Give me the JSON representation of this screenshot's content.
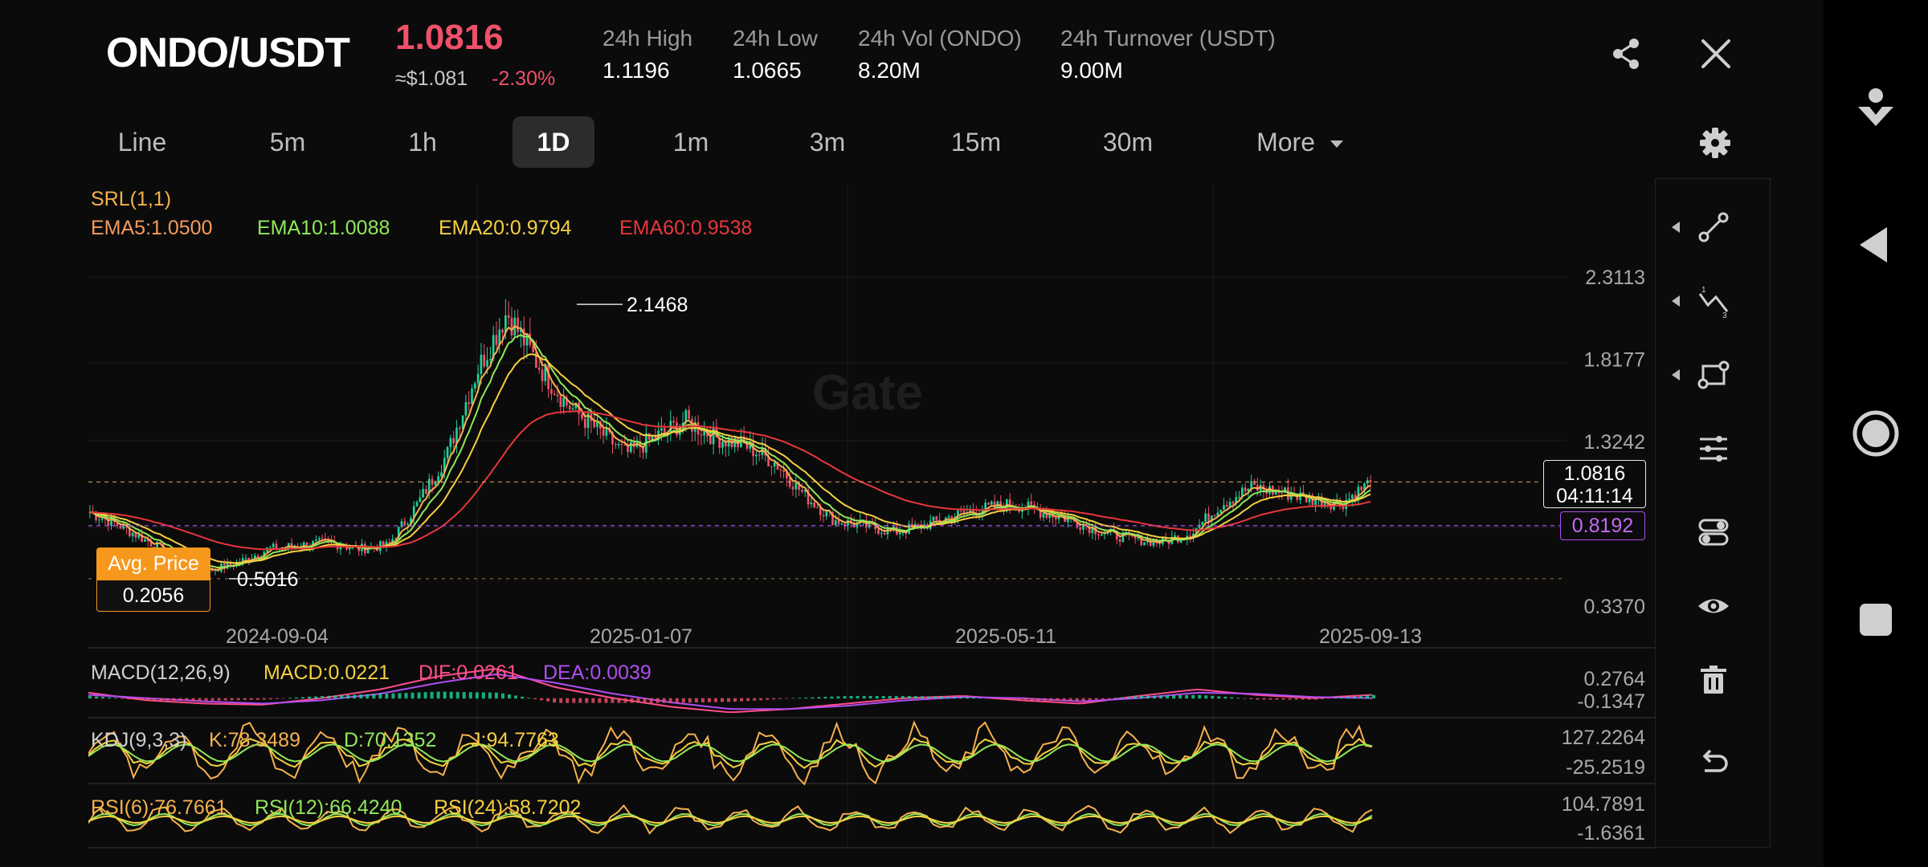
{
  "header": {
    "pair": "ONDO/USDT",
    "price": "1.0816",
    "approx": "≈$1.081",
    "change": "-2.30%",
    "stats": [
      {
        "label": "24h High",
        "value": "1.1196"
      },
      {
        "label": "24h Low",
        "value": "1.0665"
      },
      {
        "label": "24h Vol (ONDO)",
        "value": "8.20M"
      },
      {
        "label": "24h Turnover (USDT)",
        "value": "9.00M"
      }
    ],
    "share_icon": "share-icon",
    "close_icon": "close-icon"
  },
  "tabs": {
    "items": [
      "Line",
      "5m",
      "1h",
      "1D",
      "1m",
      "3m",
      "15m",
      "30m",
      "More"
    ],
    "active": "1D",
    "settings_icon": "gear-icon"
  },
  "indicators": {
    "srl": "SRL(1,1)",
    "ema5": "EMA5:1.0500",
    "ema10": "EMA10:1.0088",
    "ema20": "EMA20:0.9794",
    "ema60": "EMA60:0.9538",
    "macd_title": "MACD(12,26,9)",
    "macd_value": "MACD:0.0221",
    "dif": "DIF:0.0261",
    "dea": "DEA:0.0039",
    "kdj_title": "KDJ(9,3,3)",
    "k": "K:78.3489",
    "d": "D:70.1352",
    "j": "J:94.7763",
    "rsi6": "RSI(6):76.7661",
    "rsi12": "RSI(12):66.4240",
    "rsi24": "RSI(24):58.7202"
  },
  "labels": {
    "avg_price_label": "Avg. Price",
    "avg_price_value": "0.2056",
    "current_price": "1.0816",
    "countdown": "04:11:14",
    "avg_line_value": "0.8192",
    "watermark": "Gate"
  },
  "colors": {
    "up": "#1ed39a",
    "down": "#f0516a",
    "ema5": "#f6b04e",
    "ema10": "#8fe85a",
    "ema20": "#f4d03f",
    "ema60": "#e8363c",
    "dif": "#ff4d8d",
    "dea": "#b04df2",
    "accent_avg": "#f6981c"
  },
  "chart_data": [
    {
      "type": "candlestick",
      "title": "ONDO/USDT 1D",
      "y_ticks": [
        "2.3113",
        "1.8177",
        "1.3242",
        "0.3370"
      ],
      "x_ticks": [
        "2024-09-04",
        "2025-01-07",
        "2025-05-11",
        "2025-09-13"
      ],
      "ylim": [
        0.337,
        2.3113
      ],
      "annotations": {
        "high": 2.1468,
        "low": 0.5016,
        "last": 1.0816
      },
      "closes": [
        0.9,
        0.82,
        0.72,
        0.62,
        0.55,
        0.6,
        0.68,
        0.7,
        0.72,
        0.68,
        0.7,
        0.95,
        1.25,
        1.75,
        2.1,
        1.8,
        1.55,
        1.4,
        1.25,
        1.35,
        1.45,
        1.35,
        1.3,
        1.2,
        1.0,
        0.85,
        0.82,
        0.78,
        0.82,
        0.88,
        0.92,
        0.95,
        0.9,
        0.85,
        0.78,
        0.74,
        0.72,
        0.78,
        0.95,
        1.05,
        1.02,
        0.98,
        0.95,
        1.08
      ]
    },
    {
      "type": "line",
      "title": "MACD(12,26,9)",
      "y_ticks": [
        "0.2764",
        "-0.1347"
      ],
      "series": [
        {
          "name": "DIF",
          "values": [
            0.05,
            -0.02,
            -0.05,
            -0.06,
            0.0,
            0.08,
            0.2,
            0.27,
            0.1,
            0.0,
            -0.08,
            -0.13,
            -0.1,
            -0.05,
            0.0,
            0.02,
            -0.02,
            -0.05,
            0.02,
            0.08,
            0.03,
            0.0,
            0.03
          ]
        },
        {
          "name": "DEA",
          "values": [
            0.03,
            0.0,
            -0.03,
            -0.05,
            -0.02,
            0.04,
            0.14,
            0.22,
            0.14,
            0.04,
            -0.04,
            -0.1,
            -0.1,
            -0.07,
            -0.02,
            0.01,
            0.0,
            -0.03,
            0.0,
            0.05,
            0.04,
            0.01,
            0.0
          ]
        }
      ]
    },
    {
      "type": "line",
      "title": "KDJ(9,3,3)",
      "y_ticks": [
        "127.2264",
        "-25.2519"
      ]
    },
    {
      "type": "line",
      "title": "RSI",
      "y_ticks": [
        "104.7891",
        "-1.6361"
      ]
    }
  ],
  "toolbar": {
    "tools": [
      "trend-line-icon",
      "fib-icon",
      "rectangle-icon",
      "indicator-settings-icon",
      "toggle-icon",
      "eye-icon",
      "trash-icon",
      "undo-icon"
    ]
  },
  "system_nav": {
    "icons": [
      "download-icon",
      "back-icon",
      "home-icon",
      "recents-icon"
    ]
  }
}
